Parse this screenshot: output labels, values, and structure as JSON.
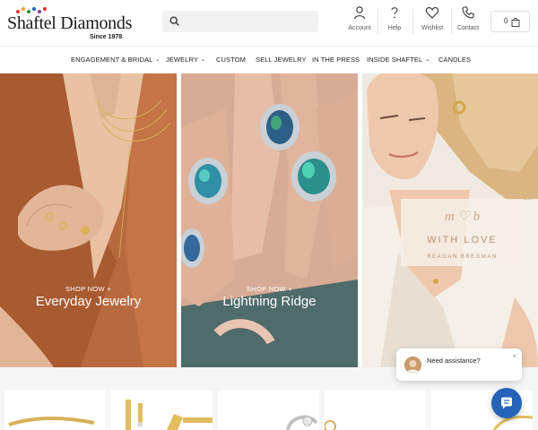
{
  "brand": {
    "name": "Shaftel Diamonds",
    "since": "Since 1978"
  },
  "search": {
    "placeholder": ""
  },
  "header_actions": {
    "account": "Account",
    "help": "Help",
    "wishlist": "Wishlist",
    "contact": "Contact",
    "cart_count": "0"
  },
  "nav": {
    "items": [
      {
        "label": "ENGAGEMENT & BRIDAL",
        "has_dropdown": true
      },
      {
        "label": "JEWELRY",
        "has_dropdown": true
      },
      {
        "label": "CUSTOM",
        "has_dropdown": false
      },
      {
        "label": "SELL JEWELRY",
        "has_dropdown": false
      },
      {
        "label": "IN THE PRESS",
        "has_dropdown": false
      },
      {
        "label": "INSIDE SHAFTEL",
        "has_dropdown": true
      },
      {
        "label": "CANDLES",
        "has_dropdown": false
      }
    ],
    "chevron": "⌄"
  },
  "hero": {
    "panels": [
      {
        "kicker": "SHOP NOW +",
        "title": "Everyday Jewelry"
      },
      {
        "kicker": "SHOP NOW +",
        "title": "Lightning Ridge"
      }
    ],
    "collab": {
      "script": "m ♡ b",
      "line1": "WITH LOVE",
      "line2": "REAGAN BREGMAN"
    }
  },
  "chat": {
    "prompt": "Need assistance?",
    "close": "×"
  },
  "colors": {
    "accent_blue": "#2563b8",
    "logo_dots": [
      "#e2352b",
      "#f2a21b",
      "#2b8a3e",
      "#1f5fbf",
      "#7b3fb0",
      "#e2352b"
    ]
  }
}
